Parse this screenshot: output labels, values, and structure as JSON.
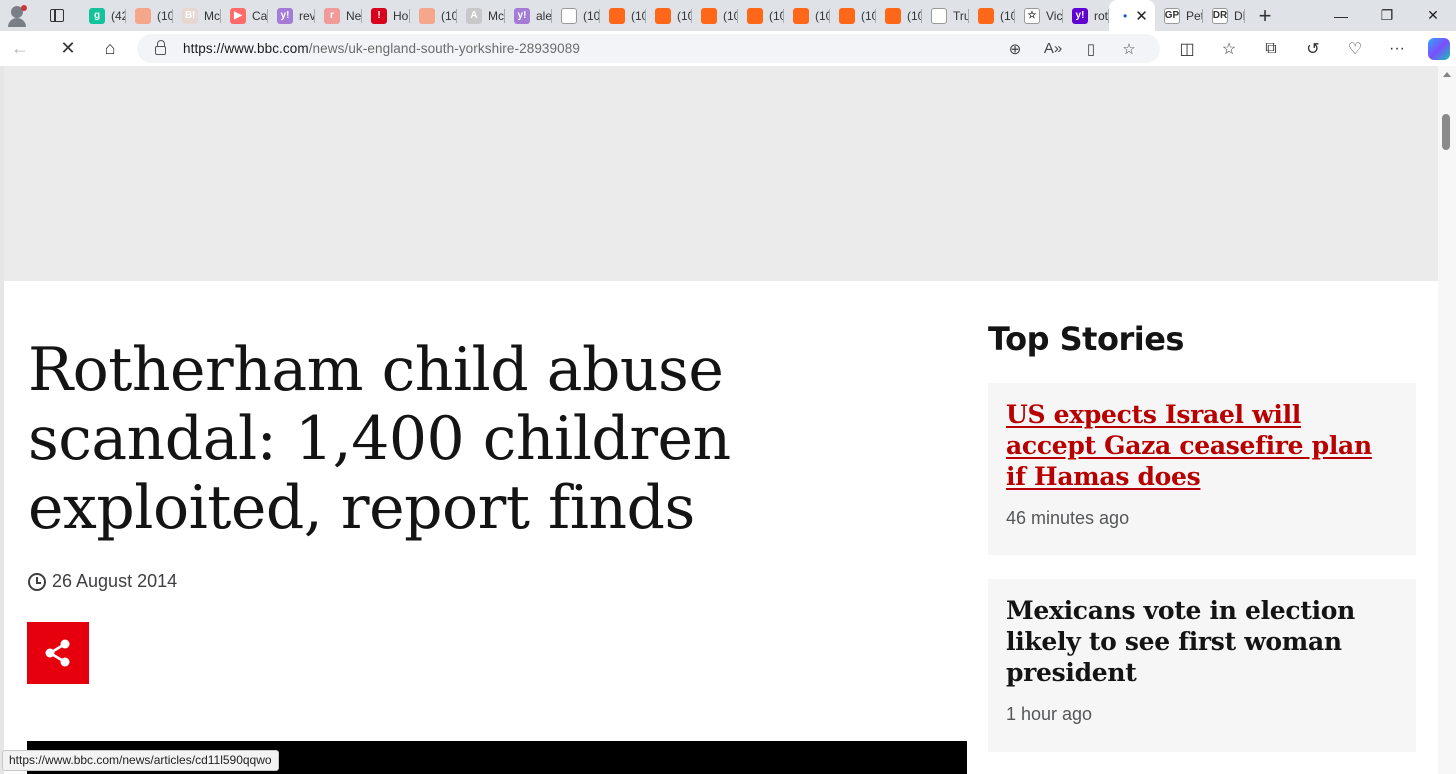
{
  "browser": {
    "tabs": [
      {
        "title": "(42",
        "favicon": "grammarly-icon",
        "color": "#15c39a",
        "glyph": "g"
      },
      {
        "title": "(10",
        "favicon": "substack-icon",
        "color": "#f4a78a",
        "glyph": ""
      },
      {
        "title": "Mc",
        "favicon": "business-insider-icon",
        "color": "#e8d6d0",
        "glyph": "BI"
      },
      {
        "title": "Ca",
        "favicon": "youtube-icon",
        "color": "#ff6b6b",
        "glyph": "▶"
      },
      {
        "title": "rev",
        "favicon": "yahoo-icon",
        "color": "#a57bd8",
        "glyph": "y!"
      },
      {
        "title": "Ne",
        "favicon": "news-icon",
        "color": "#f09a9a",
        "glyph": "r"
      },
      {
        "title": "Ho",
        "favicon": "alert-icon",
        "color": "#d9001b",
        "glyph": "!"
      },
      {
        "title": "(10",
        "favicon": "substack-icon",
        "color": "#f4a78a",
        "glyph": ""
      },
      {
        "title": "Mc",
        "favicon": "translate-icon",
        "color": "#c8c8c8",
        "glyph": "A"
      },
      {
        "title": "ale",
        "favicon": "yahoo-icon",
        "color": "#a57bd8",
        "glyph": "y!"
      },
      {
        "title": "(10",
        "favicon": "page-icon",
        "color": "#ffffff",
        "glyph": ""
      },
      {
        "title": "(10",
        "favicon": "substack-icon",
        "color": "#ff6719",
        "glyph": ""
      },
      {
        "title": "(10",
        "favicon": "substack-icon",
        "color": "#ff6719",
        "glyph": ""
      },
      {
        "title": "(10",
        "favicon": "substack-icon",
        "color": "#ff6719",
        "glyph": ""
      },
      {
        "title": "(10",
        "favicon": "substack-icon",
        "color": "#ff6719",
        "glyph": ""
      },
      {
        "title": "(10",
        "favicon": "substack-icon",
        "color": "#ff6719",
        "glyph": ""
      },
      {
        "title": "(10",
        "favicon": "substack-icon",
        "color": "#ff6719",
        "glyph": ""
      },
      {
        "title": "(10",
        "favicon": "substack-icon",
        "color": "#ff6719",
        "glyph": ""
      },
      {
        "title": "Tru",
        "favicon": "page-icon",
        "color": "#ffffff",
        "glyph": ""
      },
      {
        "title": "(10",
        "favicon": "substack-icon",
        "color": "#ff6719",
        "glyph": ""
      },
      {
        "title": "Vic",
        "favicon": "star-icon",
        "color": "#ffffff",
        "glyph": "☆"
      },
      {
        "title": "rot",
        "favicon": "yahoo-icon",
        "color": "#6001d2",
        "glyph": "y!"
      },
      {
        "title": "Pet",
        "favicon": "gp-icon",
        "color": "#ffffff",
        "glyph": "GP"
      },
      {
        "title": "DR",
        "favicon": "dr-icon",
        "color": "#ffffff",
        "glyph": "DR"
      }
    ],
    "url_host": "https://www.bbc.com",
    "url_path": "/news/uk-england-south-yorkshire-28939089",
    "status_url": "https://www.bbc.com/news/articles/cd11l590qqwo"
  },
  "article": {
    "headline": "Rotherham child abuse scandal: 1,400 children exploited, report finds",
    "date": "26 August 2014"
  },
  "sidebar": {
    "title": "Top Stories",
    "stories": [
      {
        "title": "US expects Israel will accept Gaza ceasefire plan if Hamas does",
        "time": "46 minutes ago"
      },
      {
        "title": "Mexicans vote in election likely to see first woman president",
        "time": "1 hour ago"
      }
    ]
  },
  "colors": {
    "share_red": "#e6000d",
    "link_red": "#b80000",
    "ad_grey": "#ebebeb",
    "card_grey": "#f6f6f6"
  }
}
